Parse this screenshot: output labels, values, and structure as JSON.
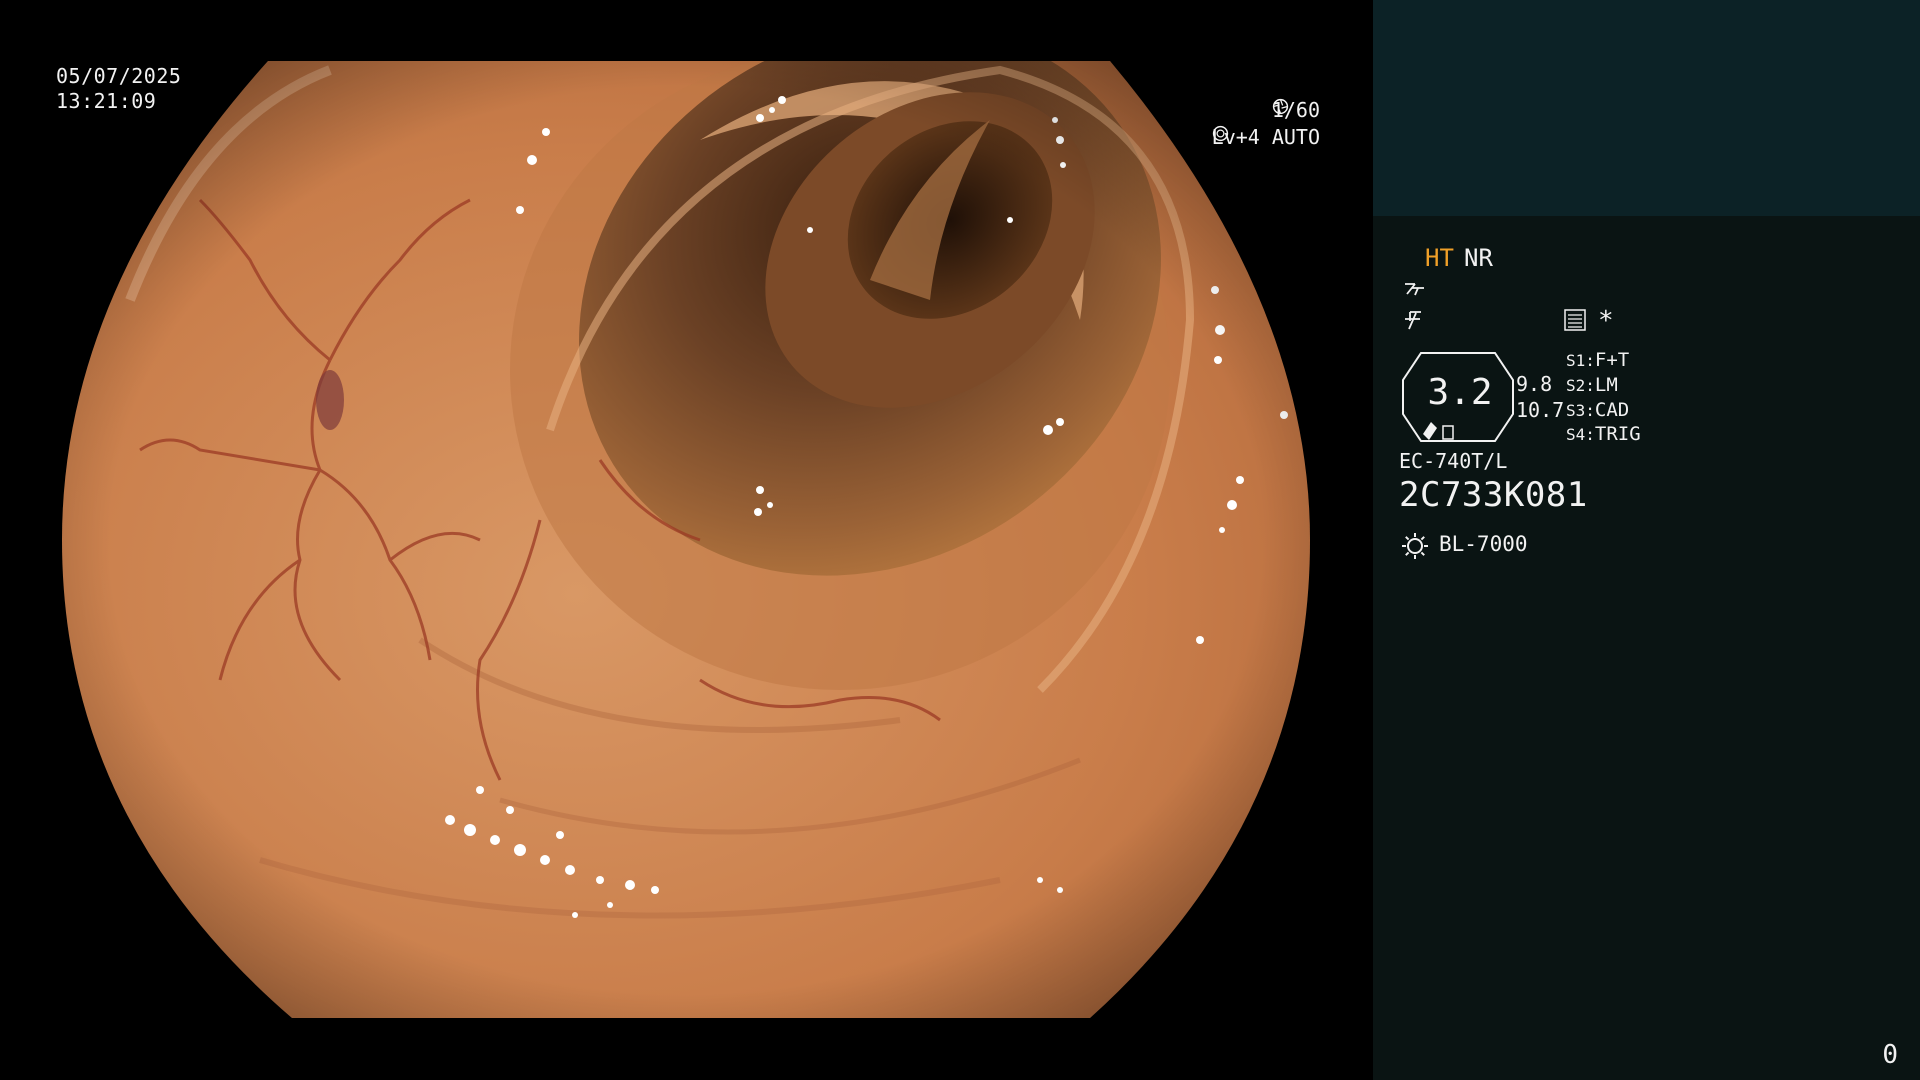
{
  "overlay": {
    "date": "05/07/2025",
    "time": "13:21:09",
    "shutter": "1/60",
    "shutter_icon": "shutter-icon",
    "level": "Lv+4",
    "exposure_mode": "AUTO",
    "exposure_icon": "iris-icon"
  },
  "panel": {
    "ht": "HT",
    "nr": "NR",
    "ht_color": "#f0a028",
    "mode_icon_1": "structure-enhance-icon",
    "mode_icon_2": "color-enhance-icon",
    "menu_icon": "menu-list-icon",
    "star": "*",
    "zoom": "3.2",
    "zoom_a": "9.8",
    "zoom_b": "10.7",
    "switches": [
      {
        "key": "S1:",
        "value": "F+T"
      },
      {
        "key": "S2:",
        "value": "LM"
      },
      {
        "key": "S3:",
        "value": "CAD"
      },
      {
        "key": "S4:",
        "value": "TRIG"
      }
    ],
    "scope_model": "EC-740T/L",
    "serial": "2C733K081",
    "lamp_icon": "light-source-icon",
    "lamp": "BL-7000",
    "counter": "0",
    "background_top": "#0c2226",
    "background": "#0a1413"
  }
}
